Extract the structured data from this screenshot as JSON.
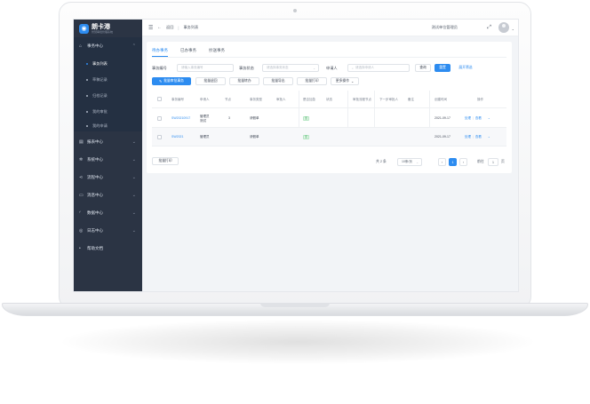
{
  "sidebar": {
    "logo_title": "朗卡港",
    "logo_subtitle": "智慧审批管理系统",
    "groups": [
      {
        "label": "事务中心",
        "icon": "home-icon"
      },
      {
        "label": "报表中心",
        "icon": "chart-icon"
      },
      {
        "label": "系统中心",
        "icon": "gear-icon"
      },
      {
        "label": "流程中心",
        "icon": "share-icon"
      },
      {
        "label": "消息中心",
        "icon": "message-icon"
      },
      {
        "label": "数据中心",
        "icon": "database-icon"
      },
      {
        "label": "日志中心",
        "icon": "log-icon"
      },
      {
        "label": "帮助文档",
        "icon": "help-icon"
      }
    ],
    "sub_items": [
      {
        "label": "事务列表",
        "active": true
      },
      {
        "label": "草稿记录",
        "active": false
      },
      {
        "label": "归档记录",
        "active": false
      },
      {
        "label": "我的审批",
        "active": false
      },
      {
        "label": "我的申请",
        "active": false
      }
    ]
  },
  "topbar": {
    "back_label": "返回",
    "crumb": "事务列表",
    "user_org": "测试单位管理员"
  },
  "tabs": [
    {
      "label": "待办事务",
      "active": true
    },
    {
      "label": "已办事务",
      "active": false
    },
    {
      "label": "抄送事务",
      "active": false
    }
  ],
  "filters": {
    "f1_label": "事务编号",
    "f1_placeholder": "请输入事务编号",
    "f2_label": "事务状态",
    "f2_placeholder": "请选择事务状态",
    "f3_label": "申请人",
    "f3_placeholder": "请选择申请人",
    "query_label": "查询",
    "reset_label": "重置",
    "expand_label": "展开筛选"
  },
  "toolbar": {
    "btn1": "批量审批事务",
    "btn2": "批量退回",
    "btn3": "批量转办",
    "btn4": "批量导出",
    "btn5": "批量打印",
    "btn6": "更多操作"
  },
  "table": {
    "columns": [
      "事务编号",
      "申请人",
      "节点",
      "事务类型",
      "审批人",
      "是否加急",
      "状态",
      "审批流程节点",
      "下一步审批人",
      "备注",
      "创建时间",
      "操作"
    ],
    "rows": [
      {
        "id": "SW20210917",
        "applicant": "管理员",
        "sub": "测试",
        "node": "3",
        "type": "请假单",
        "urgent": "否",
        "created": "2021-09-17",
        "edit": "处理",
        "view": "查看"
      },
      {
        "id": "SW2021",
        "applicant": "管理员",
        "sub": "",
        "node": "",
        "type": "请假单",
        "urgent": "否",
        "created": "2021-09-17",
        "edit": "处理",
        "view": "查看"
      }
    ]
  },
  "pager": {
    "total": "共 2 条",
    "page_size": "10条/页",
    "prev": "‹",
    "current": "1",
    "next": "›",
    "goto_label": "前往",
    "goto_value": "1",
    "page_unit": "页"
  }
}
